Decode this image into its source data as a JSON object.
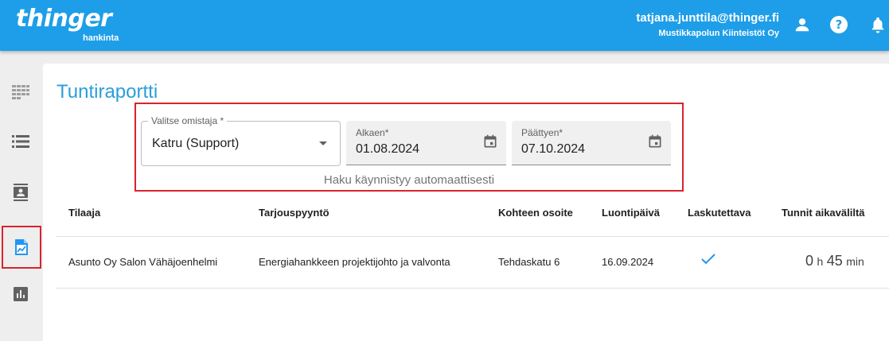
{
  "header": {
    "logo_main": "thinger",
    "logo_sub": "hankinta",
    "user_email": "tatjana.junttila@thinger.fi",
    "user_org": "Mustikkapolun Kiinteistöt Oy",
    "icons": [
      "account-icon",
      "help-icon",
      "bell-icon"
    ]
  },
  "sidebar": {
    "items": [
      {
        "icon": "grid-icon"
      },
      {
        "icon": "list-icon"
      },
      {
        "icon": "contacts-icon"
      },
      {
        "icon": "report-icon",
        "active": true
      },
      {
        "icon": "bar-chart-icon"
      }
    ]
  },
  "page": {
    "title": "Tuntiraportti"
  },
  "filters": {
    "owner_label": "Valitse omistaja *",
    "owner_value": "Katru  (Support)",
    "start_label": "Alkaen*",
    "start_value": "01.08.2024",
    "end_label": "Päättyen*",
    "end_value": "07.10.2024",
    "auto_note": "Haku käynnistyy automaattisesti"
  },
  "table": {
    "headers": [
      "Tilaaja",
      "Tarjouspyyntö",
      "Kohteen osoite",
      "Luontipäivä",
      "Laskutettava",
      "Tunnit aikaväliltä"
    ],
    "rows": [
      {
        "tilaaja": "Asunto Oy Salon Vähäjoenhelmi",
        "tarjouspyynto": "Energiahankkeen projektijohto ja valvonta",
        "osoite": "Tehdaskatu 6",
        "luontipaiva": "16.09.2024",
        "laskutettava": true,
        "hours": "0",
        "hours_unit": "h",
        "minutes": "45",
        "minutes_unit": "min"
      }
    ]
  },
  "colors": {
    "app_bar": "#1e9ee8",
    "title": "#2a9fd8",
    "highlight": "#d9232e",
    "check": "#2196f3"
  }
}
